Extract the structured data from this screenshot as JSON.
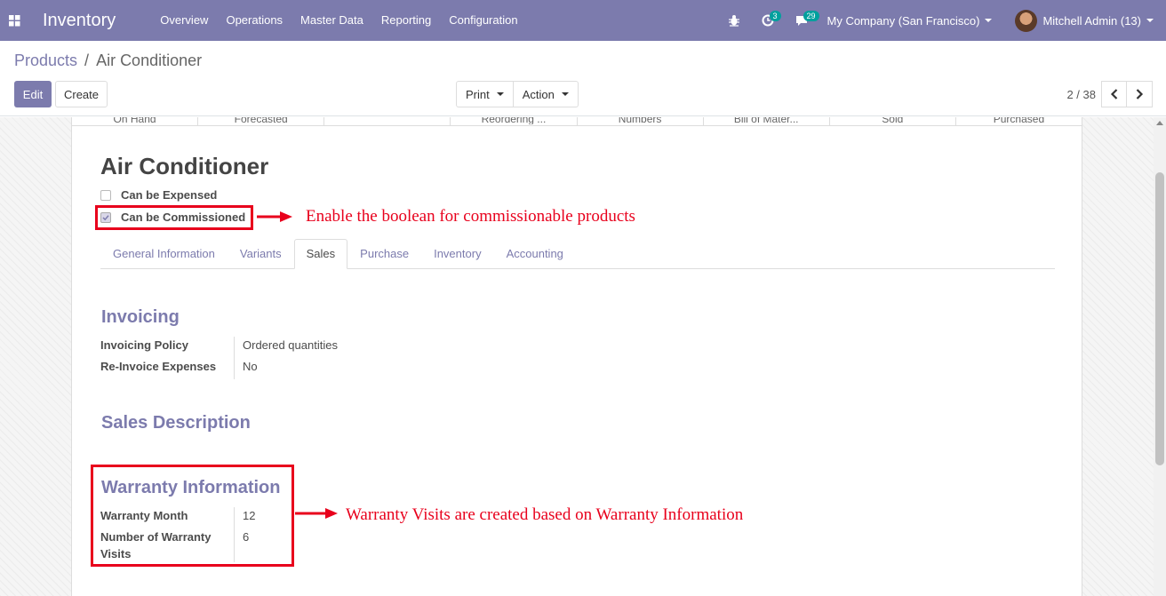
{
  "navbar": {
    "app_name": "Inventory",
    "menu": [
      "Overview",
      "Operations",
      "Master Data",
      "Reporting",
      "Configuration"
    ],
    "activity_count": "3",
    "message_count": "29",
    "company": "My Company (San Francisco)",
    "user": "Mitchell Admin (13)"
  },
  "breadcrumb": {
    "parent": "Products",
    "separator": "/",
    "current": "Air Conditioner"
  },
  "toolbar": {
    "edit": "Edit",
    "create": "Create",
    "print": "Print",
    "action": "Action"
  },
  "pager": {
    "value": "2 / 38"
  },
  "stat_buttons": [
    "On Hand",
    "Forecasted",
    "",
    "Reordering ...",
    "Numbers",
    "Bill of Mater...",
    "Sold",
    "Purchased"
  ],
  "product": {
    "name": "Air Conditioner",
    "can_be_expensed": {
      "label": "Can be Expensed",
      "checked": false
    },
    "can_be_commissioned": {
      "label": "Can be Commissioned",
      "checked": true
    }
  },
  "tabs": [
    "General Information",
    "Variants",
    "Sales",
    "Purchase",
    "Inventory",
    "Accounting"
  ],
  "active_tab": "Sales",
  "invoicing": {
    "title": "Invoicing",
    "policy_label": "Invoicing Policy",
    "policy_value": "Ordered quantities",
    "reinvoice_label": "Re-Invoice Expenses",
    "reinvoice_value": "No"
  },
  "sales_description": {
    "title": "Sales Description"
  },
  "warranty": {
    "title": "Warranty Information",
    "month_label": "Warranty Month",
    "month_value": "12",
    "visits_label": "Number of Warranty Visits",
    "visits_value": "6"
  },
  "annotations": {
    "commission": "Enable the boolean for commissionable products",
    "warranty": "Warranty Visits are created based on Warranty Information"
  },
  "colors": {
    "navbar": "#7c7bad",
    "accent": "#7c7bad",
    "annotation": "#e8001c",
    "badge": "#00a09d"
  }
}
